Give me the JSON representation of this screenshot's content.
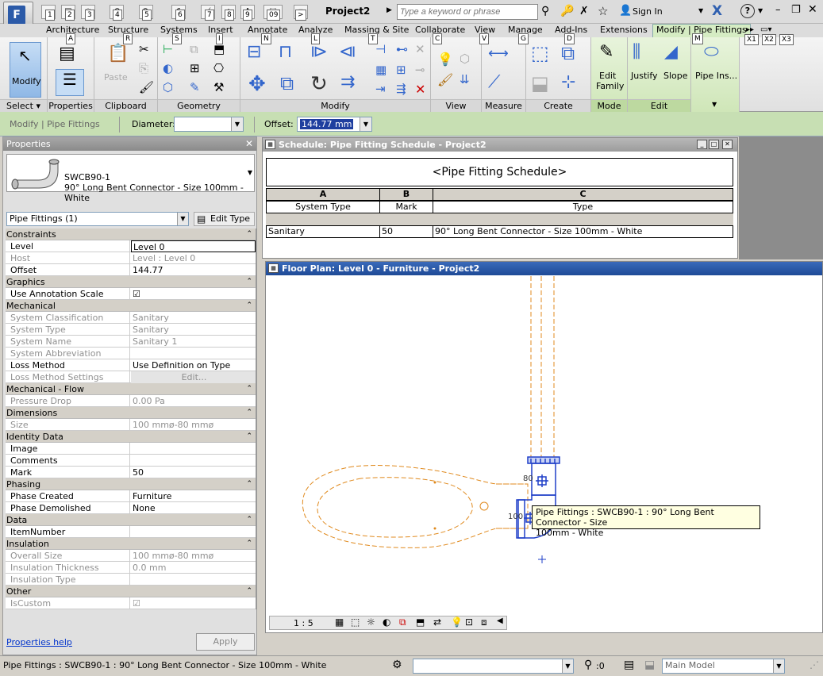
{
  "app": {
    "document_title": "Project2"
  },
  "search": {
    "placeholder": "Type a keyword or phrase"
  },
  "user": {
    "signin": "Sign In"
  },
  "keytips": {
    "qat": [
      "1",
      "2",
      "3",
      "4",
      "5",
      "6",
      "7",
      "8",
      "9",
      "09",
      ">"
    ],
    "tabs": [
      "A",
      "R",
      "S",
      "I",
      "T",
      "N",
      "L",
      "C",
      "V",
      "G",
      "D",
      "M"
    ],
    "extra": [
      "X1",
      "X2",
      "X3"
    ]
  },
  "tabs": [
    "Architecture",
    "Structure",
    "Systems",
    "Insert",
    "Annotate",
    "Analyze",
    "Massing & Site",
    "Collaborate",
    "View",
    "Manage",
    "Add-Ins",
    "Extensions",
    "Modify | Pipe Fittings"
  ],
  "ribbon": {
    "panels": {
      "select": "Select",
      "properties": "Properties",
      "clipboard": "Clipboard",
      "geometry": "Geometry",
      "modify": "Modify",
      "view": "View",
      "measure": "Measure",
      "create": "Create",
      "mode": "Mode",
      "edit": "Edit"
    },
    "buttons": {
      "modify": "Modify",
      "paste": "Paste",
      "edit_family_1": "Edit",
      "edit_family_2": "Family",
      "justify": "Justify",
      "slope": "Slope",
      "pipe_insulation": "Pipe Ins..."
    }
  },
  "options_bar": {
    "context": "Modify | Pipe Fittings",
    "diameter_label": "Diameter:",
    "diameter_value": "",
    "offset_label": "Offset:",
    "offset_value": "144.77 mm"
  },
  "properties": {
    "title": "Properties",
    "type_name_1": "SWCB90-1",
    "type_name_2": "90° Long Bent Connector - Size 100mm - White",
    "instance_selector": "Pipe Fittings (1)",
    "edit_type": "Edit Type",
    "groups": [
      {
        "name": "Constraints",
        "rows": [
          {
            "k": "Level",
            "v": "Level 0",
            "dis": false
          },
          {
            "k": "Host",
            "v": "Level : Level 0",
            "dis": true
          },
          {
            "k": "Offset",
            "v": "144.77",
            "dis": false
          }
        ]
      },
      {
        "name": "Graphics",
        "rows": [
          {
            "k": "Use Annotation Scale",
            "v": "☑",
            "dis": false
          }
        ]
      },
      {
        "name": "Mechanical",
        "rows": [
          {
            "k": "System Classification",
            "v": "Sanitary",
            "dis": true
          },
          {
            "k": "System Type",
            "v": "Sanitary",
            "dis": true
          },
          {
            "k": "System Name",
            "v": "Sanitary 1",
            "dis": true
          },
          {
            "k": "System Abbreviation",
            "v": "",
            "dis": true
          },
          {
            "k": "Loss Method",
            "v": "Use Definition on Type",
            "dis": false
          },
          {
            "k": "Loss Method Settings",
            "v": "Edit...",
            "dis": true
          }
        ]
      },
      {
        "name": "Mechanical - Flow",
        "rows": [
          {
            "k": "Pressure Drop",
            "v": "0.00 Pa",
            "dis": true
          }
        ]
      },
      {
        "name": "Dimensions",
        "rows": [
          {
            "k": "Size",
            "v": "100 mmø-80 mmø",
            "dis": true
          }
        ]
      },
      {
        "name": "Identity Data",
        "rows": [
          {
            "k": "Image",
            "v": "",
            "dis": false
          },
          {
            "k": "Comments",
            "v": "",
            "dis": false
          },
          {
            "k": "Mark",
            "v": "50",
            "dis": false
          }
        ]
      },
      {
        "name": "Phasing",
        "rows": [
          {
            "k": "Phase Created",
            "v": "Furniture",
            "dis": false
          },
          {
            "k": "Phase Demolished",
            "v": "None",
            "dis": false
          }
        ]
      },
      {
        "name": "Data",
        "rows": [
          {
            "k": "ItemNumber",
            "v": "",
            "dis": false
          }
        ]
      },
      {
        "name": "Insulation",
        "rows": [
          {
            "k": "Overall Size",
            "v": "100 mmø-80 mmø",
            "dis": true
          },
          {
            "k": "Insulation Thickness",
            "v": "0.0 mm",
            "dis": true
          },
          {
            "k": "Insulation Type",
            "v": "",
            "dis": true
          }
        ]
      },
      {
        "name": "Other",
        "rows": [
          {
            "k": "IsCustom",
            "v": "☑",
            "dis": true
          }
        ]
      }
    ],
    "help_link": "Properties help",
    "apply": "Apply"
  },
  "schedule": {
    "window_title": "Schedule: Pipe Fitting Schedule - Project2",
    "title": "<Pipe Fitting Schedule>",
    "col_letters": [
      "A",
      "B",
      "C"
    ],
    "col_headers": [
      "System Type",
      "Mark",
      "Type"
    ],
    "rows": [
      [
        "Sanitary",
        "50",
        "90° Long Bent Connector - Size 100mm - White"
      ]
    ]
  },
  "floor_plan": {
    "window_title": "Floor Plan: Level 0 - Furniture - Project2",
    "scale": "1 : 5",
    "dim_80": "80",
    "dim_100": "100",
    "tooltip_1": "Pipe Fittings : SWCB90-1 : 90° Long Bent Connector - Size",
    "tooltip_2": "100mm - White"
  },
  "status": {
    "text": "Pipe Fittings : SWCB90-1 : 90° Long Bent Connector - Size 100mm - White",
    "zero": ":0",
    "model": "Main Model"
  },
  "colors": {
    "accent_green": "#c7dfb3",
    "title_blue": "#1e4a96",
    "plan_orange": "#e08a1e",
    "select_blue": "#1f3fc8"
  }
}
